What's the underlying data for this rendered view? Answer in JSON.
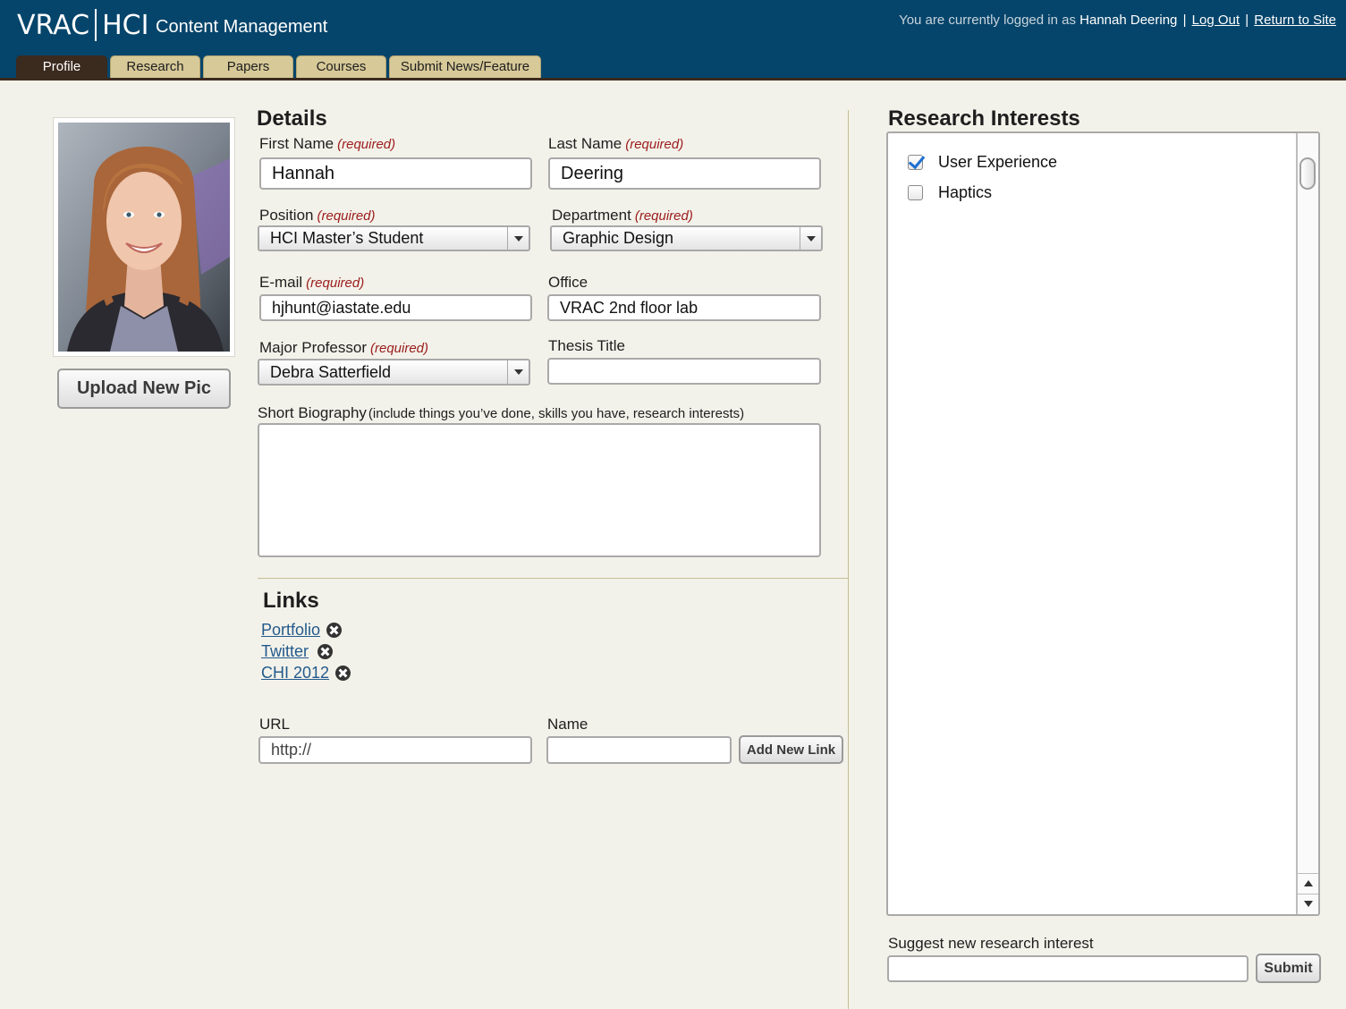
{
  "header": {
    "logo_left": "VRAC",
    "logo_right": "HCI",
    "app_title": "Content Management",
    "login_prefix": "You are currently logged in as",
    "user_name": "Hannah Deering",
    "separator": "|",
    "logout_label": "Log Out",
    "return_label": "Return to Site"
  },
  "tabs": [
    {
      "label": "Profile",
      "active": true
    },
    {
      "label": "Research",
      "active": false
    },
    {
      "label": "Papers",
      "active": false
    },
    {
      "label": "Courses",
      "active": false
    },
    {
      "label": "Submit News/Feature",
      "active": false
    }
  ],
  "profile": {
    "upload_label": "Upload New Pic"
  },
  "details": {
    "title": "Details",
    "required_text": "(required)",
    "first_name": {
      "label": "First Name",
      "value": "Hannah"
    },
    "last_name": {
      "label": "Last Name",
      "value": "Deering"
    },
    "position": {
      "label": "Position",
      "value": "HCI Master’s Student"
    },
    "department": {
      "label": "Department",
      "value": "Graphic Design"
    },
    "email": {
      "label": "E-mail",
      "value": "hjhunt@iastate.edu"
    },
    "office": {
      "label": "Office",
      "value": "VRAC 2nd floor lab"
    },
    "major_professor": {
      "label": "Major Professor",
      "value": "Debra Satterfield"
    },
    "thesis_title": {
      "label": "Thesis Title",
      "value": ""
    },
    "bio": {
      "label": "Short Biography",
      "hint": "(include things you’ve done, skills you have, research interests)",
      "value": ""
    }
  },
  "links": {
    "title": "Links",
    "items": [
      {
        "label": "Portfolio"
      },
      {
        "label": "Twitter"
      },
      {
        "label": "CHI 2012"
      }
    ],
    "url_label": "URL",
    "url_value": "http://",
    "name_label": "Name",
    "name_value": "",
    "add_label": "Add New Link"
  },
  "research_interests": {
    "title": "Research Interests",
    "items": [
      {
        "label": "User Experience",
        "checked": true
      },
      {
        "label": "Haptics",
        "checked": false
      }
    ],
    "suggest_label": "Suggest new research interest",
    "suggest_value": "",
    "submit_label": "Submit"
  },
  "colors": {
    "header_bg": "#06456b",
    "tab_bg": "#d7c998",
    "tab_active_bg": "#3b2a1e",
    "page_bg": "#f3f2ea",
    "required": "#9b1c1c",
    "link": "#235a8c"
  }
}
